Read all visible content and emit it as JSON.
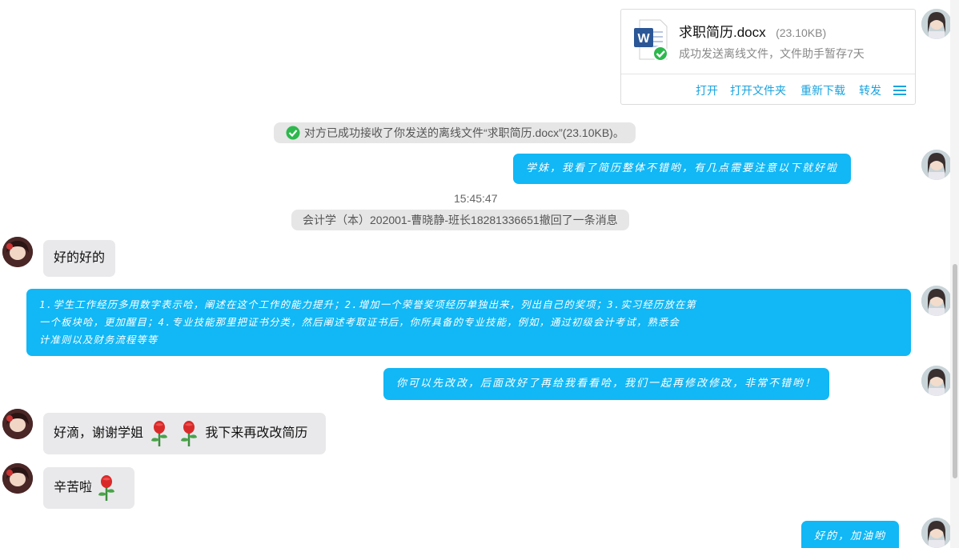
{
  "file_card": {
    "name": "求职简历.docx",
    "size": "(23.10KB)",
    "status": "成功发送离线文件，文件助手暂存7天",
    "icon": "word-doc-icon",
    "actions": [
      "打开",
      "打开文件夹",
      "重新下载",
      "转发"
    ],
    "menu_icon": "hamburger-menu-icon"
  },
  "system_notice_received": "对方已成功接收了你发送的离线文件“求职简历.docx”(23.10KB)。",
  "timestamp": "15:45:47",
  "system_notice_recall": "会计学（本）202001-曹晓静-班长18281336651撤回了一条消息",
  "messages": [
    {
      "side": "me",
      "text": "学妹，我看了简历整体不错哟，有几点需要注意以下就好啦"
    },
    {
      "side": "peer",
      "text": "好的好的"
    },
    {
      "side": "me",
      "lines": [
        "1.学生工作经历多用数字表示哈，阐述在这个工作的能力提升；2.增加一个荣誉奖项经历单独出来，列出自己的奖项；3.实习经历放在第",
        "一个板块哈，更加醒目；4.专业技能那里把证书分类，然后阐述考取证书后，你所具备的专业技能，例如，通过初级会计考试，熟悉会",
        "计准则以及财务流程等等"
      ]
    },
    {
      "side": "me",
      "text": "你可以先改改，后面改好了再给我看看哈，我们一起再修改修改，非常不错哟！"
    },
    {
      "side": "peer",
      "text_before": "好滴，谢谢学姐",
      "text_after": "我下来再改改简历",
      "emoji_icon": "rose-emoji-icon"
    },
    {
      "side": "peer",
      "text": "辛苦啦",
      "emoji_icon": "rose-emoji-icon"
    },
    {
      "side": "me",
      "text": "好的，加油哟"
    }
  ],
  "colors": {
    "my_bubble": "#12b7f5",
    "peer_bubble": "#e9e9eb",
    "link": "#1aa3de",
    "success": "#2db84d"
  }
}
